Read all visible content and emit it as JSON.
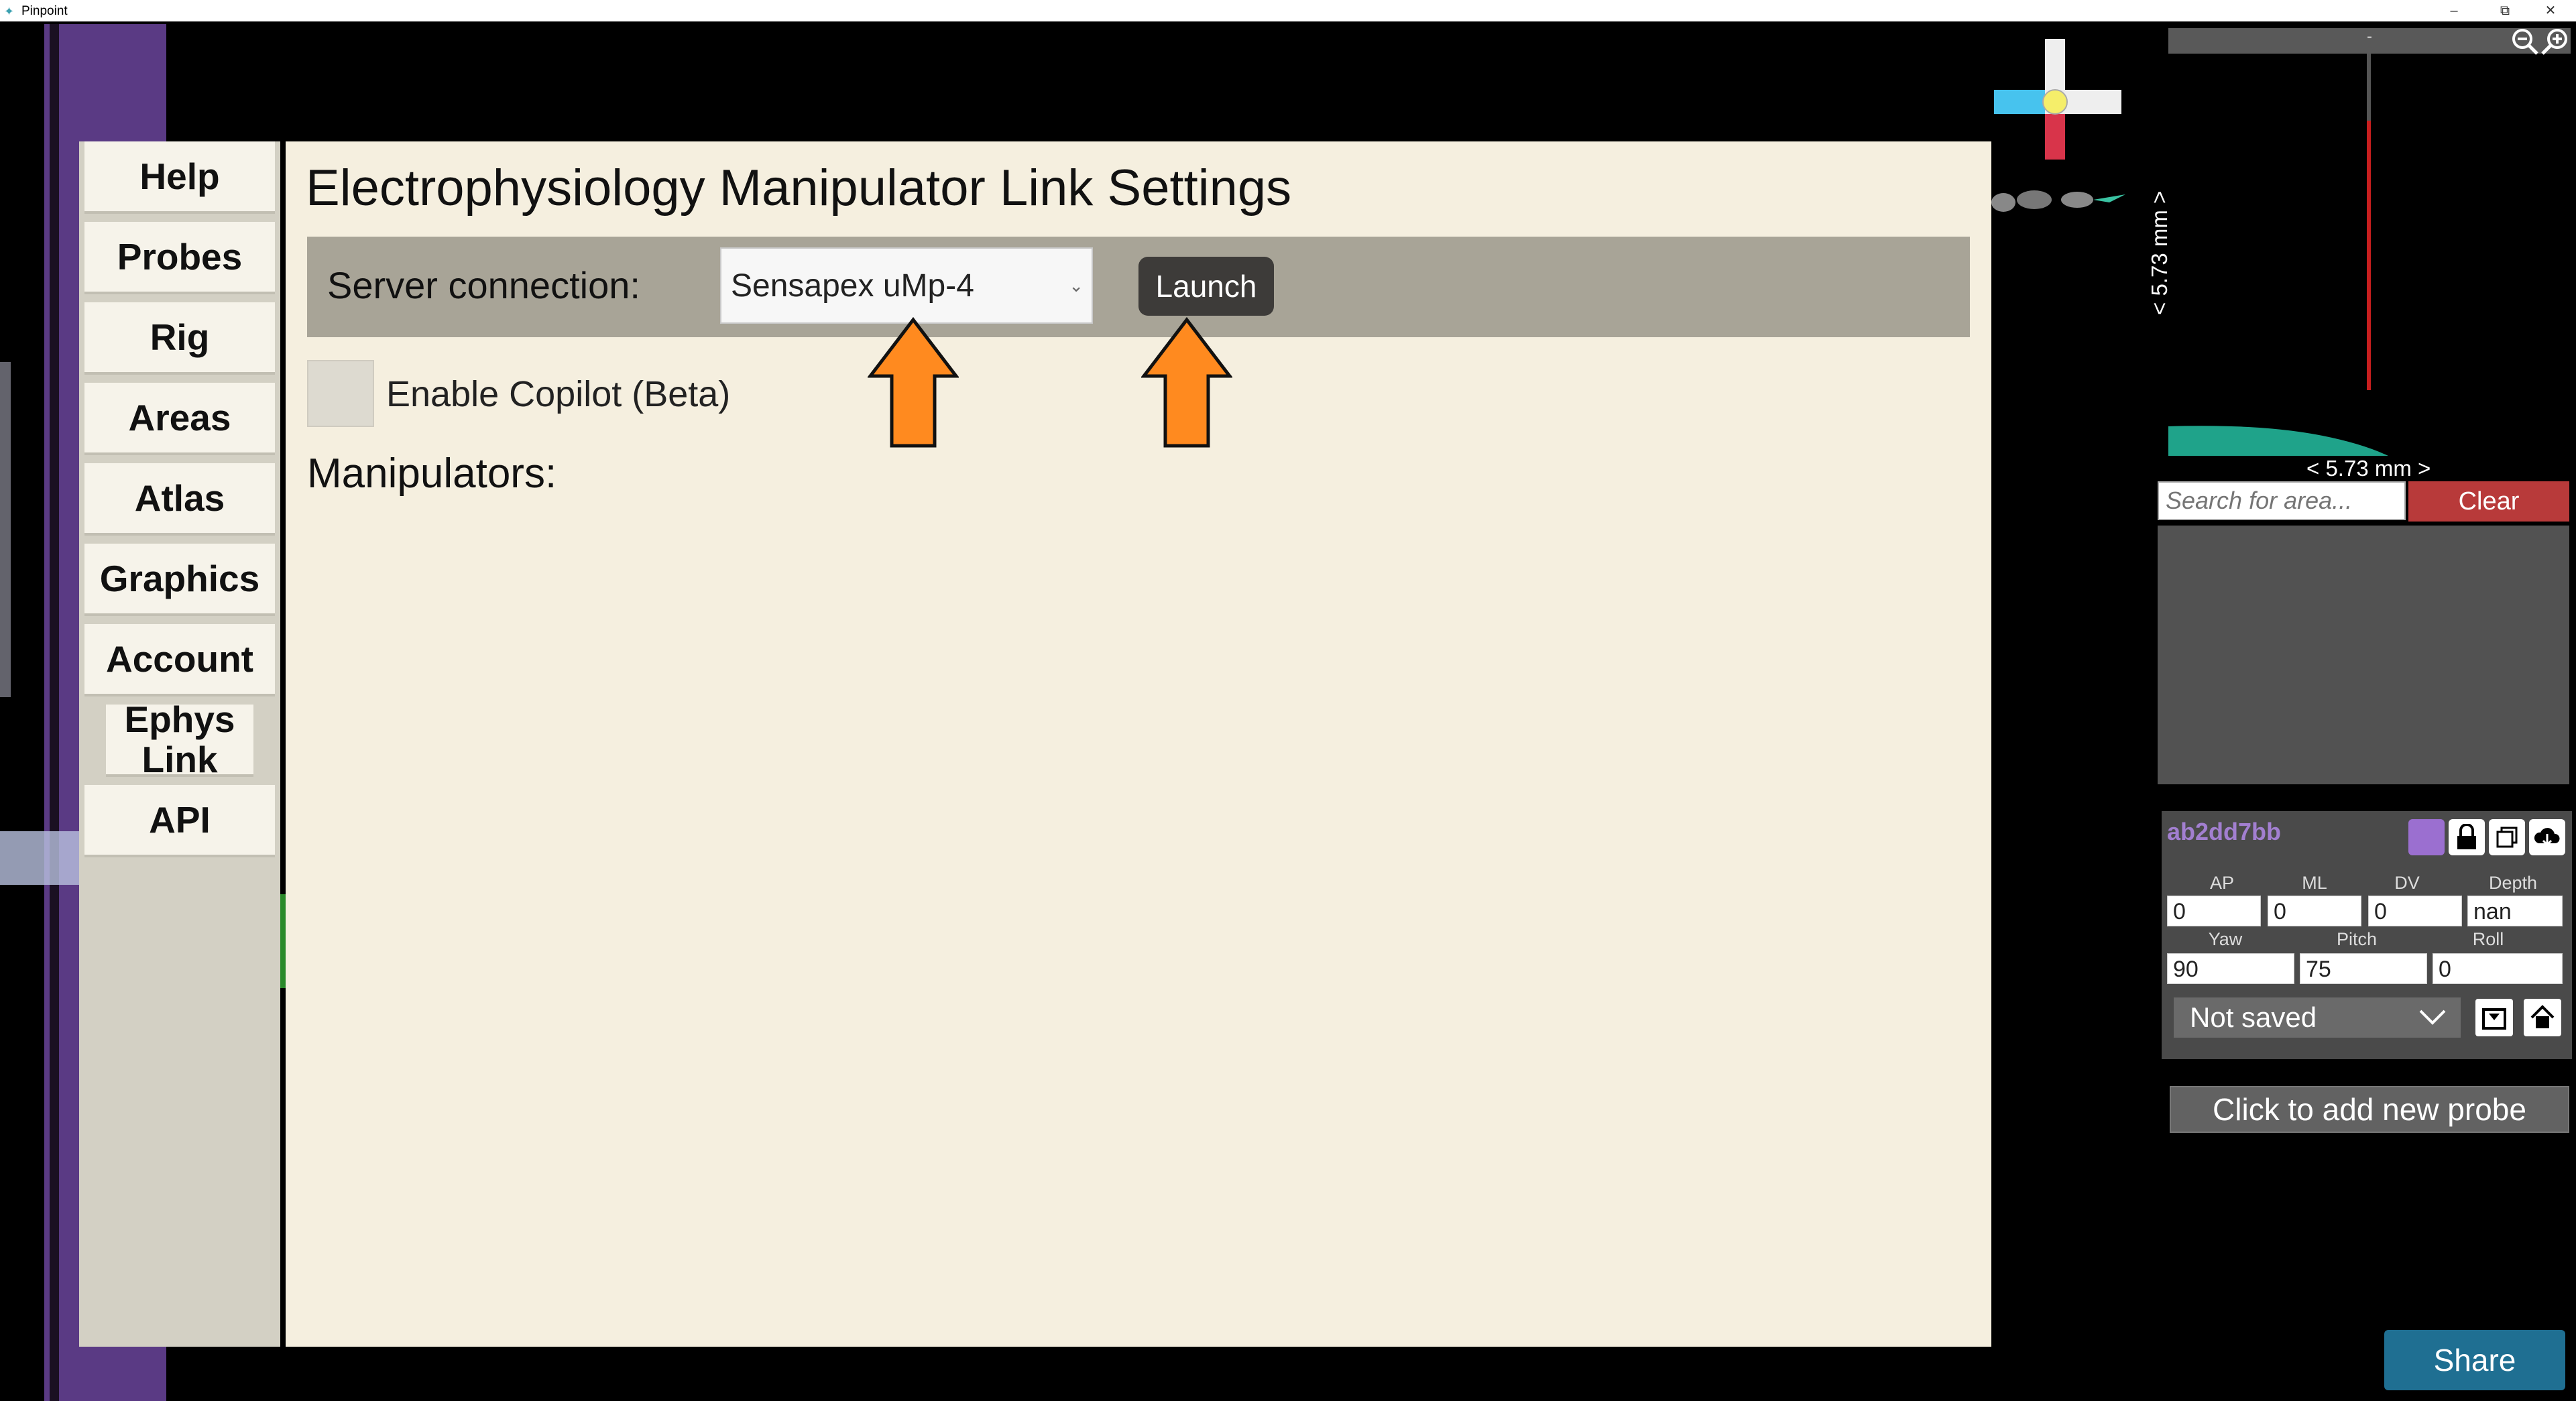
{
  "window": {
    "title": "Pinpoint",
    "minimize_glyph": "–",
    "restore_glyph": "⧉",
    "close_glyph": "✕"
  },
  "menu": {
    "items": [
      "Help",
      "Probes",
      "Rig",
      "Areas",
      "Atlas",
      "Graphics",
      "Account",
      "Ephys Link",
      "API"
    ]
  },
  "settings": {
    "title": "Electrophysiology Manipulator Link Settings",
    "server_label": "Server connection:",
    "server_value": "Sensapex uMp-4",
    "launch_label": "Launch",
    "copilot_label": "Enable Copilot (Beta)",
    "manipulators_label": "Manipulators:"
  },
  "area_viewer": {
    "header": "-",
    "scale_vertical": "< 5.73 mm >",
    "scale_horizontal": "< 5.73 mm >",
    "search_placeholder": "Search for area...",
    "clear_label": "Clear"
  },
  "probe": {
    "id": "ab2dd7bb",
    "color": "#9b6fd0",
    "labels": {
      "ap": "AP",
      "ml": "ML",
      "dv": "DV",
      "depth": "Depth",
      "yaw": "Yaw",
      "pitch": "Pitch",
      "roll": "Roll"
    },
    "values": {
      "ap": "0",
      "ml": "0",
      "dv": "0",
      "depth": "nan",
      "yaw": "90",
      "pitch": "75",
      "roll": "0"
    },
    "saved_state": "Not saved"
  },
  "add_probe_label": "Click to add new probe",
  "share_label": "Share",
  "colors": {
    "arrow": "#ff8a1f",
    "clear": "#b83a3a",
    "share": "#1f6f92",
    "panel": "#f5efdf"
  }
}
